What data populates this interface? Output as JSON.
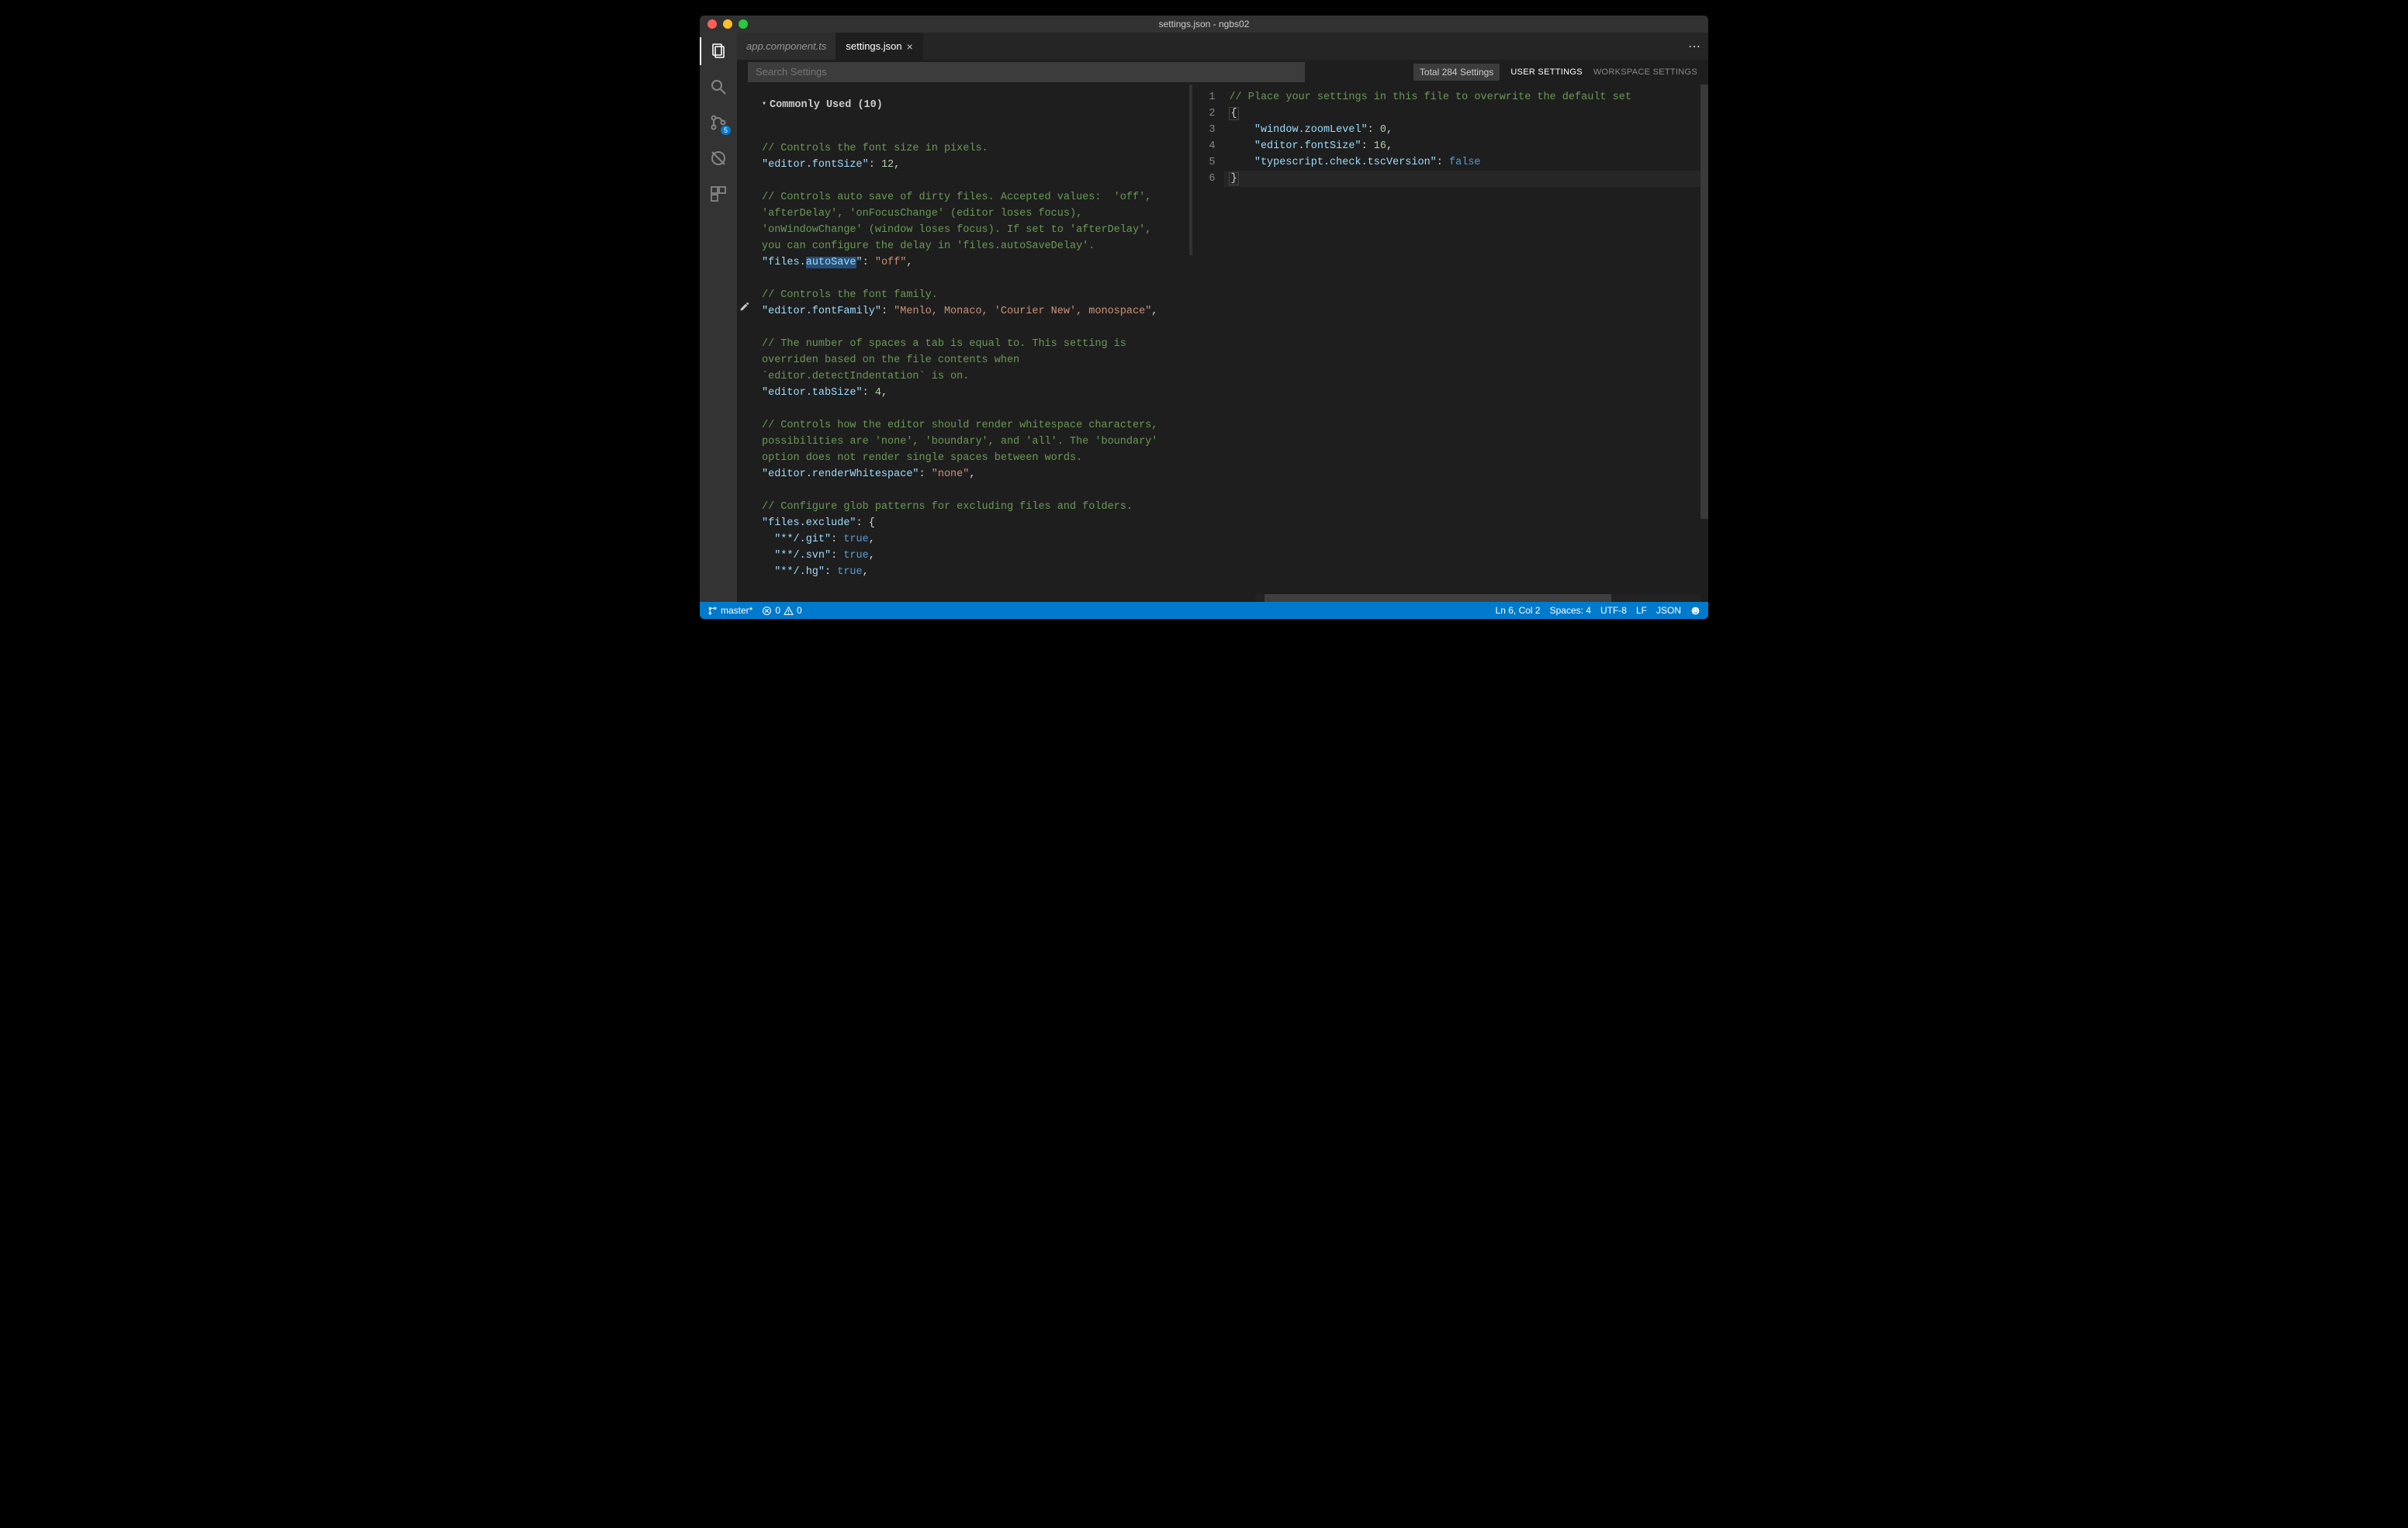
{
  "title": "settings.json - ngbs02",
  "tabs": [
    {
      "label": "app.component.ts",
      "active": false
    },
    {
      "label": "settings.json",
      "active": true
    }
  ],
  "search": {
    "placeholder": "Search Settings",
    "totalLabel": "Total 284 Settings"
  },
  "scopeTabs": {
    "user": "USER SETTINGS",
    "workspace": "WORKSPACE SETTINGS"
  },
  "section": {
    "header": "Commonly Used (10)"
  },
  "defaults": {
    "c1": "// Controls the font size in pixels.",
    "k1": "\"editor.fontSize\"",
    "v1": "12",
    "c2a": "// Controls auto save of dirty files. Accepted values:  'off',",
    "c2b": "'afterDelay', 'onFocusChange' (editor loses focus),",
    "c2c": "'onWindowChange' (window loses focus). If set to 'afterDelay',",
    "c2d": "you can configure the delay in 'files.autoSaveDelay'.",
    "k2a": "\"files.",
    "k2sel": "autoSave",
    "k2b": "\"",
    "v2": "\"off\"",
    "c3": "// Controls the font family.",
    "k3": "\"editor.fontFamily\"",
    "v3": "\"Menlo, Monaco, 'Courier New', monospace\"",
    "c4a": "// The number of spaces a tab is equal to. This setting is",
    "c4b": "overriden based on the file contents when",
    "c4c": "`editor.detectIndentation` is on.",
    "k4": "\"editor.tabSize\"",
    "v4": "4",
    "c5a": "// Controls how the editor should render whitespace characters,",
    "c5b": "possibilities are 'none', 'boundary', and 'all'. The 'boundary'",
    "c5c": "option does not render single spaces between words.",
    "k5": "\"editor.renderWhitespace\"",
    "v5": "\"none\"",
    "c6": "// Configure glob patterns for excluding files and folders.",
    "k6": "\"files.exclude\"",
    "ek1": "\"**/.git\"",
    "ev1": "true",
    "ek2": "\"**/.svn\"",
    "ev2": "true",
    "ek3": "\"**/.hg\"",
    "ev3": "true"
  },
  "user": {
    "lineNumbers": [
      "1",
      "2",
      "3",
      "4",
      "5",
      "6"
    ],
    "l1": "// Place your settings in this file to overwrite the default set",
    "brOpen": "{",
    "k1": "\"window.zoomLevel\"",
    "v1": "0",
    "k2": "\"editor.fontSize\"",
    "v2": "16",
    "k3": "\"typescript.check.tscVersion\"",
    "v3": "false",
    "brClose": "}"
  },
  "activity": {
    "gitBadge": "5"
  },
  "status": {
    "branch": "master*",
    "errors": "0",
    "warnings": "0",
    "lncol": "Ln 6, Col 2",
    "spaces": "Spaces: 4",
    "encoding": "UTF-8",
    "eol": "LF",
    "lang": "JSON"
  }
}
